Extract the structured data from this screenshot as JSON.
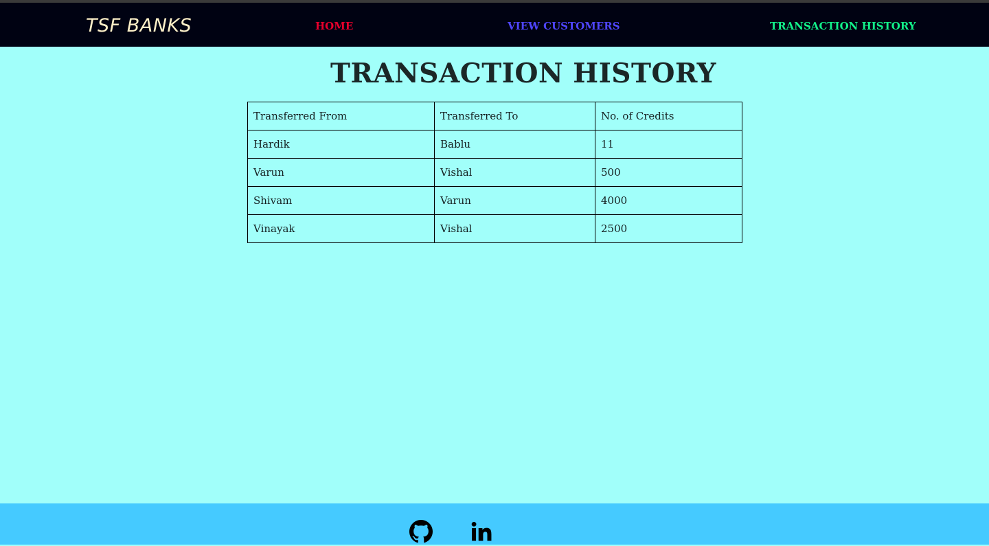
{
  "navbar": {
    "brand": "TSF BANKS",
    "links": [
      {
        "label": "HOME",
        "color": "#e8002c"
      },
      {
        "label": "VIEW CUSTOMERS",
        "color": "#4f46ff"
      },
      {
        "label": "TRANSACTION HISTORY",
        "color": "#12f28a"
      }
    ]
  },
  "main": {
    "title": "TRANSACTION HISTORY",
    "table": {
      "headers": [
        "Transferred From",
        "Transferred To",
        "No. of Credits"
      ],
      "rows": [
        [
          "Hardik",
          "Bablu",
          "11"
        ],
        [
          "Varun",
          "Vishal",
          "500"
        ],
        [
          "Shivam",
          "Varun",
          "4000"
        ],
        [
          "Vinayak",
          "Vishal",
          "2500"
        ]
      ]
    }
  },
  "footer": {
    "icons": [
      "github-icon",
      "linkedin-icon"
    ]
  },
  "colors": {
    "page_background": "#a1fffa",
    "navbar_background": "#000212",
    "footer_background": "#45caff"
  }
}
